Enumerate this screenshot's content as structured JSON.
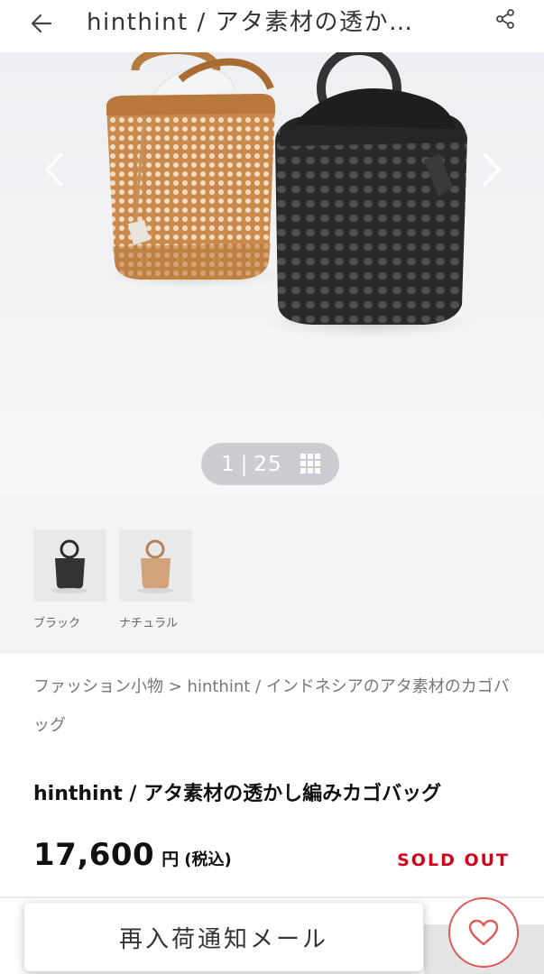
{
  "header": {
    "title": "hinthint / アタ素材の透か…",
    "back_icon": "arrow-left-icon",
    "share_icon": "share-icon"
  },
  "gallery": {
    "current": "1",
    "separator": "|",
    "total": "25",
    "prev_icon": "chevron-left-icon",
    "next_icon": "chevron-right-icon",
    "grid_icon": "grid-icon"
  },
  "variants": [
    {
      "label": "ブラック"
    },
    {
      "label": "ナチュラル"
    }
  ],
  "breadcrumb": {
    "category": "ファッション小物",
    "separator": " > ",
    "item": "hinthint / インドネシアのアタ素材のカゴバッグ"
  },
  "product": {
    "name": "hinthint / アタ素材の透かし編みカゴバッグ",
    "price": "17,600",
    "currency": "円",
    "tax": "(税込)",
    "status": "SOLD OUT"
  },
  "actions": {
    "notify_label": "再入荷通知メール",
    "favorite_icon": "heart-icon"
  },
  "colors": {
    "accent": "#d0021b",
    "heart": "#e05a5a"
  }
}
